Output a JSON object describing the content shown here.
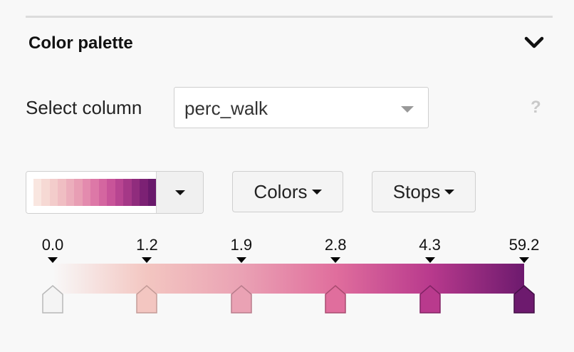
{
  "section": {
    "title": "Color palette"
  },
  "column_select": {
    "label": "Select column",
    "value": "perc_walk",
    "help": "?"
  },
  "palette": {
    "swatch_colors": [
      "#f9e6e0",
      "#f6d9d4",
      "#f3cccb",
      "#f0bec3",
      "#ecaebc",
      "#e89eb4",
      "#e38bae",
      "#dd78a7",
      "#d466a0",
      "#c85499",
      "#b84591",
      "#a53887",
      "#902c7d",
      "#7c2174",
      "#69196b"
    ]
  },
  "buttons": {
    "colors_label": "Colors",
    "stops_label": "Stops"
  },
  "stops": [
    {
      "label": "0.0",
      "color": "#f4f4f4",
      "border": "#b8b8b8"
    },
    {
      "label": "1.2",
      "color": "#f3c6c1",
      "border": "#c49c98"
    },
    {
      "label": "1.9",
      "color": "#eaa2b4",
      "border": "#b97c8c"
    },
    {
      "label": "2.8",
      "color": "#e06e9d",
      "border": "#a94c71"
    },
    {
      "label": "4.3",
      "color": "#b93a8d",
      "border": "#822365"
    },
    {
      "label": "59.2",
      "color": "#6d1a6e",
      "border": "#440f46"
    }
  ]
}
